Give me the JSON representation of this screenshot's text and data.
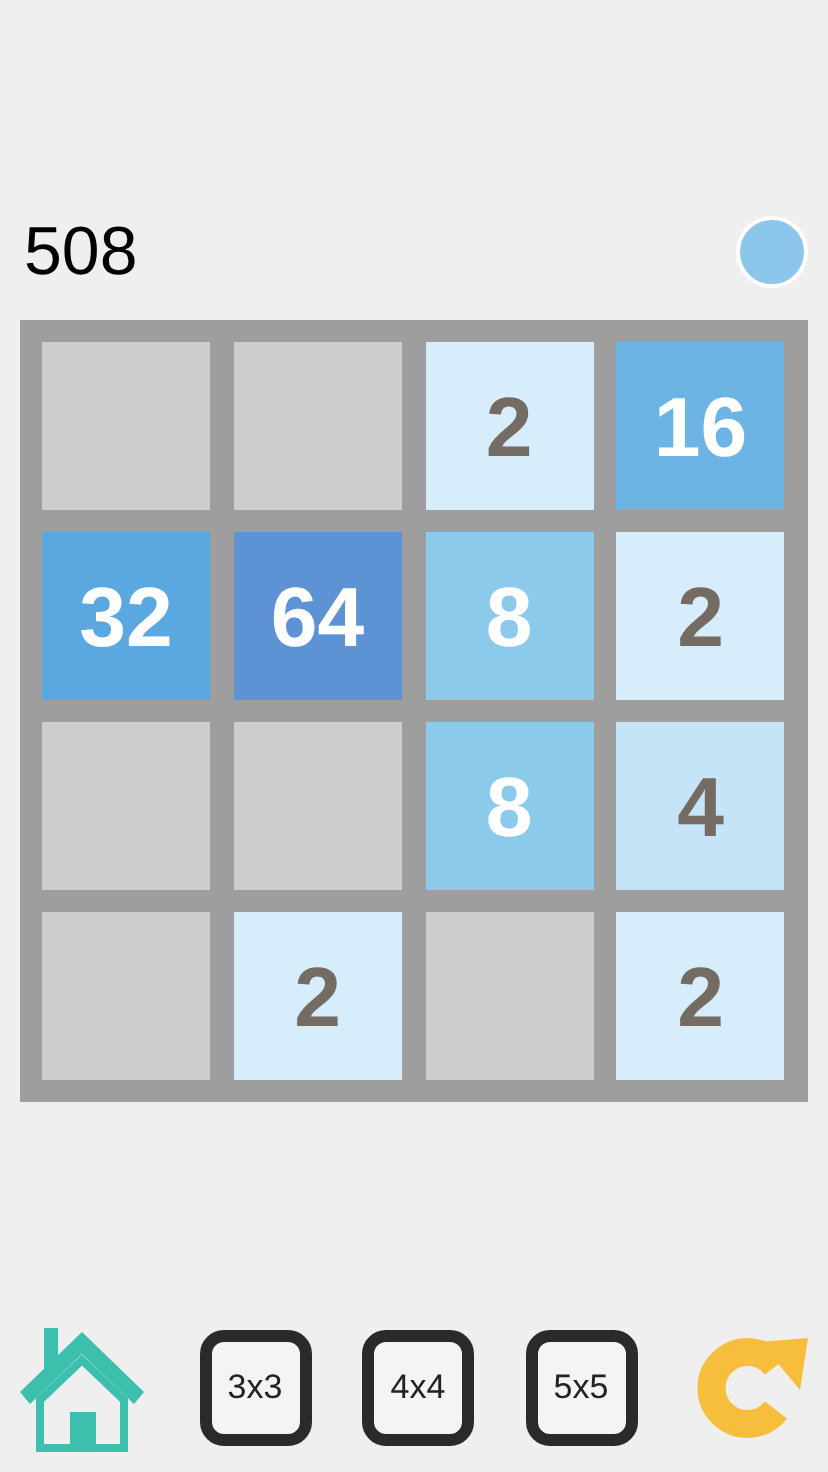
{
  "score": "508",
  "indicator": {
    "color": "#8cc6ea"
  },
  "board": {
    "tiles": [
      {
        "kind": "empty"
      },
      {
        "kind": "empty"
      },
      {
        "kind": "tile",
        "value": "2",
        "color": "#d7edfb"
      },
      {
        "kind": "tile",
        "value": "16",
        "color": "#6cb4e4"
      },
      {
        "kind": "tile",
        "value": "32",
        "color": "#5ba8e0"
      },
      {
        "kind": "tile",
        "value": "64",
        "color": "#5d93d4"
      },
      {
        "kind": "tile",
        "value": "8",
        "color": "#8ccaeb"
      },
      {
        "kind": "tile",
        "value": "2",
        "color": "#d7edfb"
      },
      {
        "kind": "empty"
      },
      {
        "kind": "empty"
      },
      {
        "kind": "tile",
        "value": "8",
        "color": "#8ccaeb"
      },
      {
        "kind": "tile",
        "value": "4",
        "color": "#c5e4f8"
      },
      {
        "kind": "empty"
      },
      {
        "kind": "tile",
        "value": "2",
        "color": "#d7edfb"
      },
      {
        "kind": "empty"
      },
      {
        "kind": "tile",
        "value": "2",
        "color": "#d7edfb"
      }
    ]
  },
  "toolbar": [
    {
      "kind": "home"
    },
    {
      "kind": "size",
      "label": "3x3"
    },
    {
      "kind": "size",
      "label": "4x4"
    },
    {
      "kind": "size",
      "label": "5x5"
    },
    {
      "kind": "restart"
    }
  ]
}
